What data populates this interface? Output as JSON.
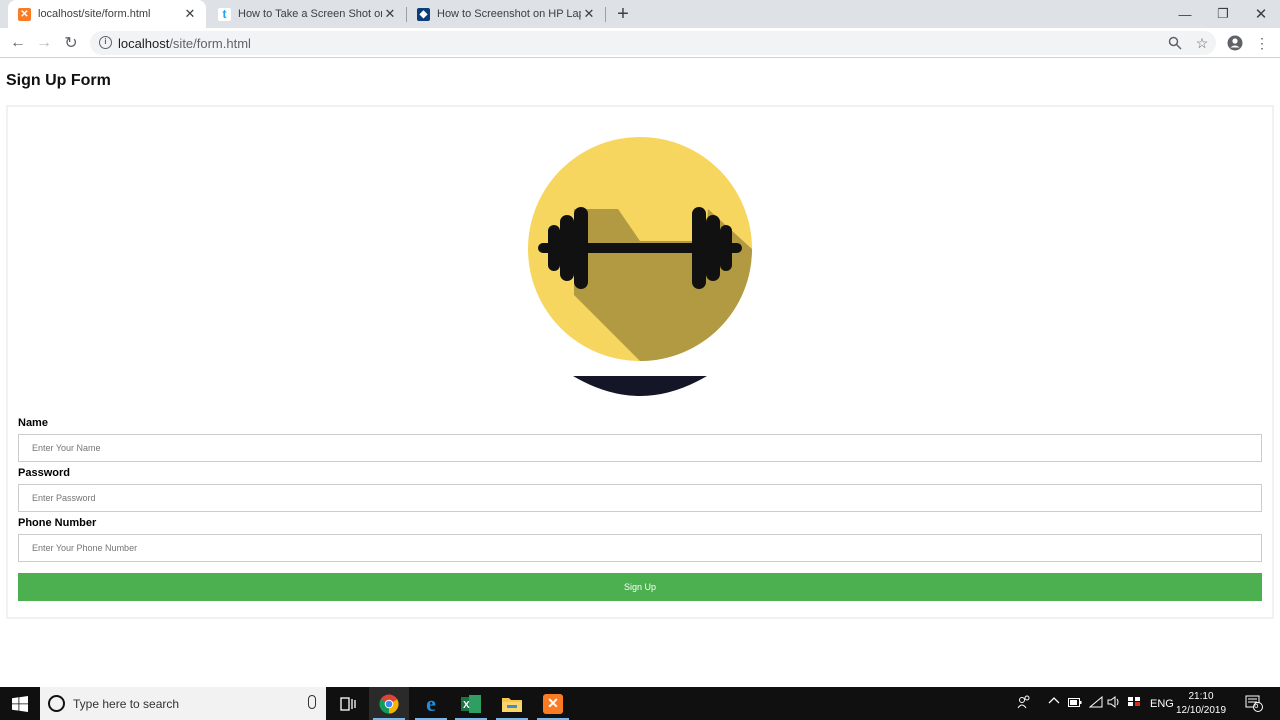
{
  "browser": {
    "tabs": [
      {
        "title": "localhost/site/form.html",
        "active": true
      },
      {
        "title": "How to Take a Screen Shot on a W",
        "active": false
      },
      {
        "title": "How to Screenshot on HP Laptop",
        "active": false
      }
    ],
    "url_host": "localhost",
    "url_path": "/site/form.html"
  },
  "page": {
    "title": "Sign Up Form",
    "fields": [
      {
        "label": "Name",
        "placeholder": "Enter Your Name"
      },
      {
        "label": "Password",
        "placeholder": "Enter Password"
      },
      {
        "label": "Phone Number",
        "placeholder": "Enter Your Phone Number"
      }
    ],
    "submit_label": "Sign Up"
  },
  "taskbar": {
    "search_placeholder": "Type here to search",
    "language": "ENG",
    "time": "21:10",
    "date": "12/10/2019",
    "notification_count": "6"
  },
  "colors": {
    "accent_green": "#4caf50",
    "avatar_yellow": "#f7d660",
    "avatar_shadow": "#b29a43"
  }
}
